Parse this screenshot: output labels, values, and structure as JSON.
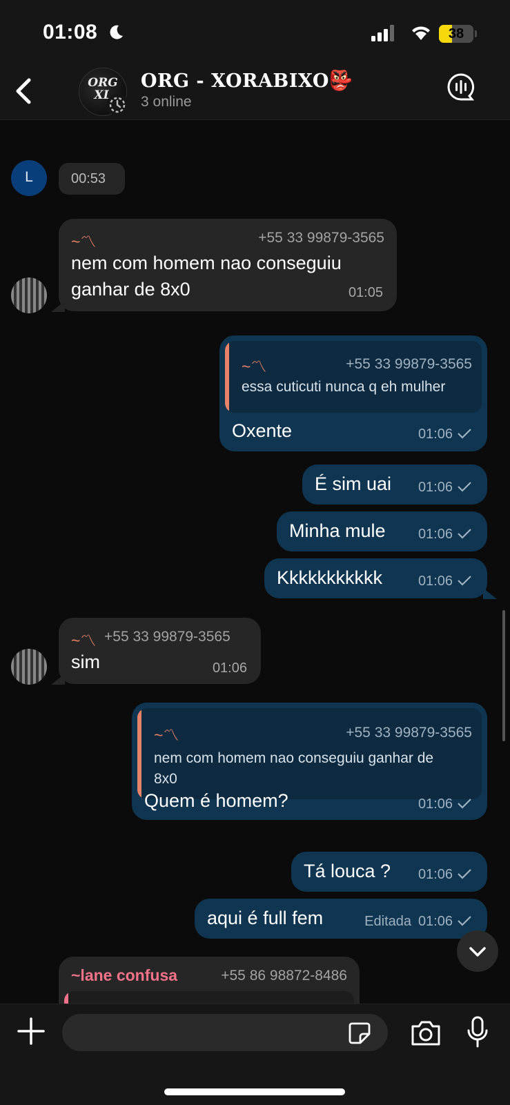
{
  "status_bar": {
    "time": "01:08",
    "battery": "38",
    "battery_level": 0.38
  },
  "header": {
    "group_name": "ORG - XORABIXO",
    "group_emoji": "👺",
    "status": "3 online",
    "avatar_text": "ORG XL"
  },
  "messages": {
    "m0": {
      "avatar_letter": "L",
      "time": "00:53"
    },
    "m1": {
      "sender": "~〽",
      "phone": "+55 33 99879-3565",
      "text_line1": "nem com homem nao conseguiu",
      "text_line2": "ganhar de 8x0",
      "time": "01:05"
    },
    "m2": {
      "quote_sender": "~〽",
      "quote_phone": "+55 33 99879-3565",
      "quote_text": "essa cuticuti nunca q eh mulher",
      "text": "Oxente",
      "time": "01:06"
    },
    "m3": {
      "text": "É sim uai",
      "time": "01:06"
    },
    "m4": {
      "text": "Minha mule",
      "time": "01:06"
    },
    "m5": {
      "text": "Kkkkkkkkkkk",
      "time": "01:06"
    },
    "m6": {
      "sender": "~〽",
      "phone": "+55 33 99879-3565",
      "text": "sim",
      "time": "01:06"
    },
    "m7": {
      "quote_sender": "~〽",
      "quote_phone": "+55 33 99879-3565",
      "quote_line1": "nem com homem nao conseguiu ganhar de",
      "quote_line2": "8x0",
      "text": "Quem é homem?",
      "time": "01:06"
    },
    "m8": {
      "text": "Tá louca ?",
      "time": "01:06"
    },
    "m9": {
      "text": "aqui é full fem",
      "edited": "Editada",
      "time": "01:06"
    },
    "m10": {
      "sender": "~lane confusa",
      "phone": "+55 86 98872-8486"
    }
  },
  "input": {
    "placeholder": ""
  },
  "icons": {
    "back": "chevron-left-icon",
    "voice_chat": "voice-chat-icon",
    "plus": "plus-icon",
    "sticker": "sticker-icon",
    "camera": "camera-icon",
    "mic": "microphone-icon",
    "scroll_down": "chevron-down-icon",
    "read_check": "check-icon"
  },
  "colors": {
    "outgoing_bubble": "#103551",
    "incoming_bubble": "#262626",
    "sender_name": "#e8836a",
    "battery": "#f5d90a"
  }
}
